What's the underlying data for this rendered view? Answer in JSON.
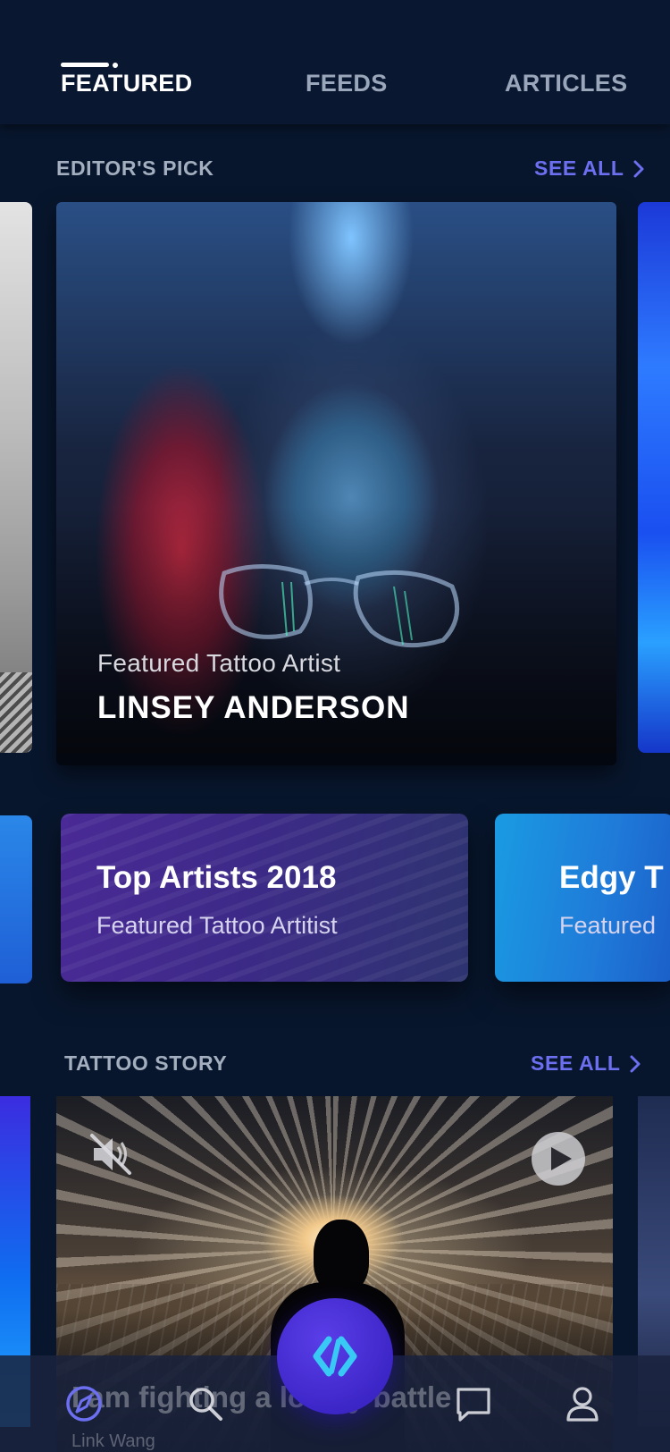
{
  "tabs": [
    {
      "label": "FEATURED",
      "active": true
    },
    {
      "label": "FEEDS",
      "active": false
    },
    {
      "label": "ARTICLES",
      "active": false
    }
  ],
  "editors_pick": {
    "heading": "EDITOR'S PICK",
    "see_all": "SEE ALL",
    "card": {
      "subtitle": "Featured Tattoo Artist",
      "name": "LINSEY ANDERSON"
    }
  },
  "collections": [
    {
      "title": "Top Artists 2018",
      "subtitle": "Featured Tattoo Artitist"
    },
    {
      "title": "Edgy  T",
      "subtitle": "Featured"
    }
  ],
  "tattoo_story": {
    "heading": "TATTOO STORY",
    "see_all": "SEE ALL",
    "story_title": "I am fighting a lonely battle",
    "author": "Link Wang"
  },
  "bottom_nav": {
    "items": [
      "compass-icon",
      "search-icon",
      "chat-icon",
      "profile-icon"
    ],
    "fab_icon": "code-icon"
  },
  "colors": {
    "background": "#08162d",
    "accent": "#6c6ff0",
    "fab": "#3d26c8"
  }
}
